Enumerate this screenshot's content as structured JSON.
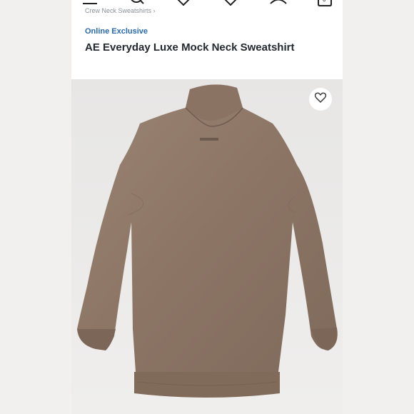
{
  "breadcrumb": {
    "label": "Crew Neck Sweatshirts ›"
  },
  "product": {
    "badge": "Online Exclusive",
    "title": "AE Everyday Luxe Mock Neck Sweatshirt"
  },
  "cart": {
    "count": "0"
  },
  "colors": {
    "accent": "#2a6aa6",
    "sweater": "#8b7566"
  },
  "icons": [
    "menu-icon",
    "search-icon",
    "heart-icon",
    "user-icon",
    "bag-icon",
    "favorite-heart-icon"
  ]
}
